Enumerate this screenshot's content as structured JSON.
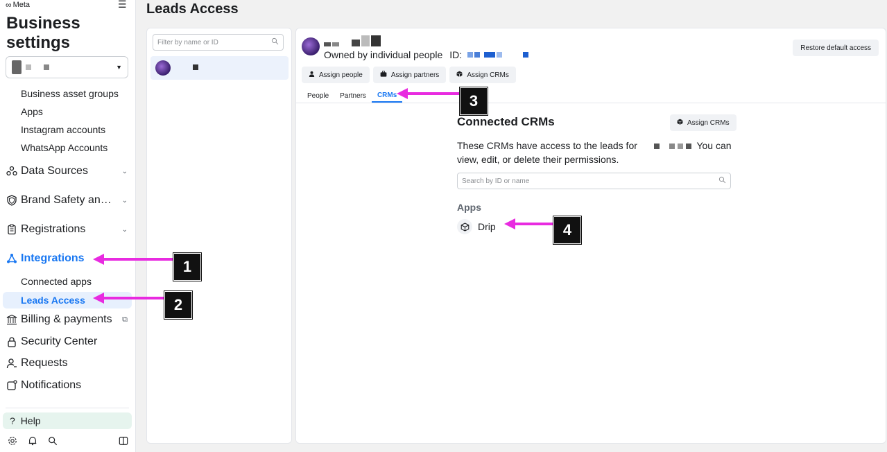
{
  "sidebar": {
    "brand": "Meta",
    "title_line1": "Business",
    "title_line2": "settings",
    "subitems_top": [
      "Business asset groups",
      "Apps",
      "Instagram accounts",
      "WhatsApp Accounts"
    ],
    "nav": {
      "data_sources": "Data Sources",
      "brand_safety": "Brand Safety an…",
      "registrations": "Registrations",
      "integrations": "Integrations",
      "connected_apps": "Connected apps",
      "leads_access": "Leads Access",
      "billing": "Billing & payments",
      "security": "Security Center",
      "requests": "Requests",
      "notifications": "Notifications"
    },
    "help": "Help"
  },
  "page": {
    "title": "Leads Access"
  },
  "left_panel": {
    "filter_placeholder": "Filter by name or ID"
  },
  "right_panel": {
    "owned_by": "Owned by individual people",
    "id_label": "ID:",
    "restore_button": "Restore default access",
    "buttons": {
      "assign_people": "Assign people",
      "assign_partners": "Assign partners",
      "assign_crms": "Assign CRMs"
    },
    "tabs": [
      "People",
      "Partners",
      "CRMs"
    ],
    "active_tab": "CRMs",
    "crm": {
      "title": "Connected CRMs",
      "assign_button": "Assign CRMs",
      "desc_part1": "These CRMs have access to the leads for",
      "desc_part2": "You can view, edit, or delete their permissions.",
      "search_placeholder": "Search by ID or name",
      "apps_heading": "Apps",
      "apps": [
        "Drip"
      ]
    }
  },
  "annotations": {
    "labels": [
      "1",
      "2",
      "3",
      "4"
    ],
    "arrow_color": "#e82be0"
  },
  "colors": {
    "accent": "#1877f2",
    "active_bg": "#e7f0fd",
    "help_bg": "#e6f4ee"
  }
}
